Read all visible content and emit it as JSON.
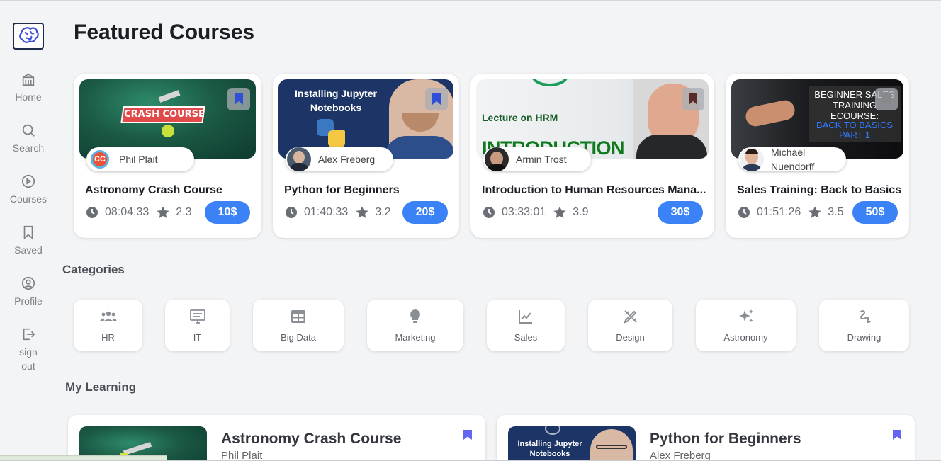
{
  "sidebar": {
    "logo": "brain-logo-icon",
    "items": [
      {
        "label": "Home",
        "icon": "building-icon"
      },
      {
        "label": "Search",
        "icon": "search-icon"
      },
      {
        "label": "Courses",
        "icon": "play-circle-icon"
      },
      {
        "label": "Saved",
        "icon": "bookmark-icon"
      },
      {
        "label": "Profile",
        "icon": "user-circle-icon"
      },
      {
        "label": "sign out",
        "icon": "sign-out-icon"
      }
    ]
  },
  "featured": {
    "title": "Featured Courses",
    "courses": [
      {
        "title": "Astronomy Crash Course",
        "author": "Phil Plait",
        "duration": "08:04:33",
        "rating": "2.3",
        "price": "10$",
        "thumb_text": "CRASH COURSE"
      },
      {
        "title": "Python for Beginners",
        "author": "Alex Freberg",
        "duration": "01:40:33",
        "rating": "3.2",
        "price": "20$",
        "thumb_text": "Installing Jupyter Notebooks"
      },
      {
        "title": "Introduction to Human Resources Mana...",
        "author": "Armin Trost",
        "duration": "03:33:01",
        "rating": "3.9",
        "price": "30$",
        "thumb_text_1": "Lecture on HRM",
        "thumb_text_2": "INTRODUCTION"
      },
      {
        "title": "Sales Training: Back to Basics",
        "author": "Michael Nuendorff",
        "duration": "01:51:26",
        "rating": "3.5",
        "price": "50$",
        "thumb_text_1": "BEGINNER SALES TRAINING ECOURSE:",
        "thumb_text_2": "BACK TO BASICS PART 1"
      }
    ]
  },
  "categories": {
    "title": "Categories",
    "items": [
      {
        "label": "HR",
        "icon": "users-icon"
      },
      {
        "label": "IT",
        "icon": "monitor-icon"
      },
      {
        "label": "Big Data",
        "icon": "table-icon"
      },
      {
        "label": "Marketing",
        "icon": "lightbulb-icon"
      },
      {
        "label": "Sales",
        "icon": "chart-line-icon"
      },
      {
        "label": "Design",
        "icon": "pencil-ruler-icon"
      },
      {
        "label": "Astronomy",
        "icon": "sparkles-icon"
      },
      {
        "label": "Drawing",
        "icon": "scribble-icon"
      }
    ]
  },
  "my_learning": {
    "title": "My Learning",
    "courses": [
      {
        "title": "Astronomy Crash Course",
        "author": "Phil Plait"
      },
      {
        "title": "Python for Beginners",
        "author": "Alex Freberg",
        "thumb_text": "Installing Jupyter Notebooks"
      }
    ]
  },
  "colors": {
    "accent": "#3b82f6",
    "bookmark": "#6366f1",
    "background": "#f3f4f6"
  }
}
